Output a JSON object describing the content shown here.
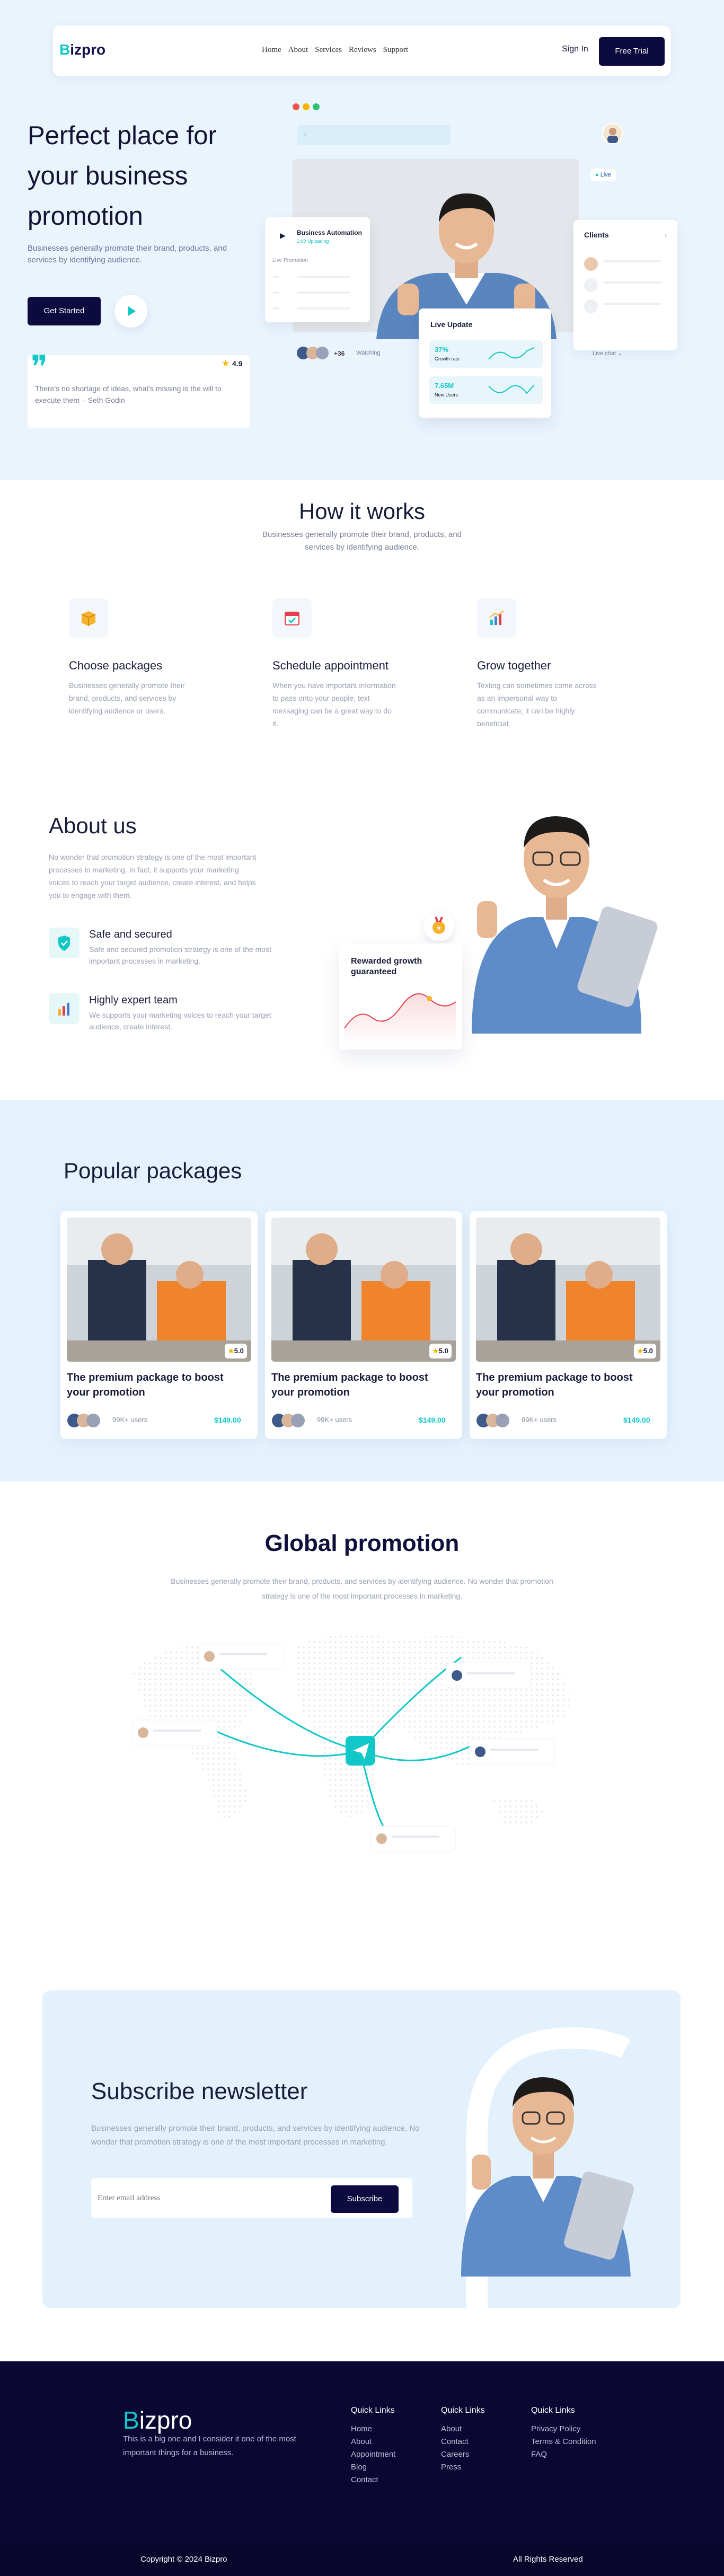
{
  "header": {
    "logo": {
      "first_letter": "B",
      "rest": "izpro"
    },
    "nav": [
      "Home",
      "About",
      "Services",
      "Reviews",
      "Support"
    ],
    "sign_in": "Sign In",
    "cta": "Free Trial"
  },
  "hero": {
    "title": "Perfect place for your business promotion",
    "subtitle": "Businesses generally promote their brand, products, and services by identifying audience.",
    "get_started": "Get Started",
    "quote": {
      "rating": "4.9",
      "text": "There's no shortage of ideas, what's missing is the will to execute them – Seth Godin"
    },
    "mock": {
      "live_tag": "Live",
      "biz_card_title": "Business Automation",
      "biz_card_sub": "1:00 Uploading",
      "biz_card_label": "Live Promotion",
      "clients_title": "Clients",
      "live_update_title": "Live Update",
      "stat1_value": "37%",
      "stat1_label": "Growth rate",
      "stat2_value": "7.65M",
      "stat2_label": "New Users",
      "watchers_count": "+36",
      "watching_label": "Watching",
      "live_chat_label": "Live chat"
    }
  },
  "how": {
    "title": "How it works",
    "subtitle": "Businesses generally promote their brand, products, and services by identifying audience.",
    "items": [
      {
        "title": "Choose packages",
        "desc": "Businesses generally promote their brand, products, and services by identifying audience or users."
      },
      {
        "title": "Schedule appointment",
        "desc": "When you have important information to pass onto your people, text messaging can be a great way to do it."
      },
      {
        "title": "Grow together",
        "desc": "Texting can sometimes come across as an impersonal way to communicate; it can be highly beneficial."
      }
    ]
  },
  "about": {
    "title": "About us",
    "text": "No wonder that promotion strategy is one of the most important processes in marketing. In fact, it supports your marketing voices to reach your target audience, create interest, and helps you to engage with them.",
    "features": [
      {
        "title": "Safe and secured",
        "desc": "Safe and secured promotion strategy is one of the most important processes in marketing."
      },
      {
        "title": "Highly expert team",
        "desc": "We supports your marketing voices to reach your target audience, create interest."
      }
    ],
    "reward_label": "Rewarded growth guaranteed"
  },
  "packages": {
    "title": "Popular packages",
    "items": [
      {
        "rating": "5.0",
        "title": "The premium package to boost your promotion",
        "users": "99K+ users",
        "price": "$149.00"
      },
      {
        "rating": "5.0",
        "title": "The premium package to boost your promotion",
        "users": "99K+ users",
        "price": "$149.00"
      },
      {
        "rating": "5.0",
        "title": "The premium package to boost your promotion",
        "users": "99K+ users",
        "price": "$149.00"
      }
    ]
  },
  "global": {
    "title": "Global  promotion",
    "subtitle": "Businesses generally promote their brand, products, and services by identifying audience. No wonder that promotion strategy is one of the most important processes in marketing."
  },
  "subscribe": {
    "title": "Subscribe newsletter",
    "text": "Businesses generally promote their brand, products, and services by identifying audience. No wonder that promotion strategy is one of the most important processes in marketing.",
    "placeholder": "Enter email address",
    "button": "Subscribe"
  },
  "footer": {
    "logo": {
      "first_letter": "B",
      "rest": "izpro"
    },
    "text": "This is a big one and I consider it one of the most important things for a business.",
    "columns": [
      {
        "title": "Quick Links",
        "links": [
          "Home",
          "About",
          "Appointment",
          "Blog",
          "Contact"
        ]
      },
      {
        "title": "Quick Links",
        "links": [
          "About",
          "Contact",
          "Careers",
          "Press"
        ]
      },
      {
        "title": "Quick Links",
        "links": [
          "Privacy Policy",
          "Terms & Condition",
          "FAQ"
        ]
      }
    ],
    "copyright": "Copyright © 2024 Bizpro",
    "rights": "All Rights Reserved"
  },
  "colors": {
    "navy": "#0c0a3e",
    "accent": "#12c7c7",
    "hero_bg": "#eaf4fd",
    "packages_bg": "#e4f2fe",
    "footer_bg": "#0a0833"
  },
  "icons": [
    "play-icon",
    "quote-icon",
    "star-icon",
    "box-icon",
    "calendar-icon",
    "chart-icon",
    "shield-icon",
    "bar-chart-icon",
    "send-icon",
    "medal-icon"
  ]
}
